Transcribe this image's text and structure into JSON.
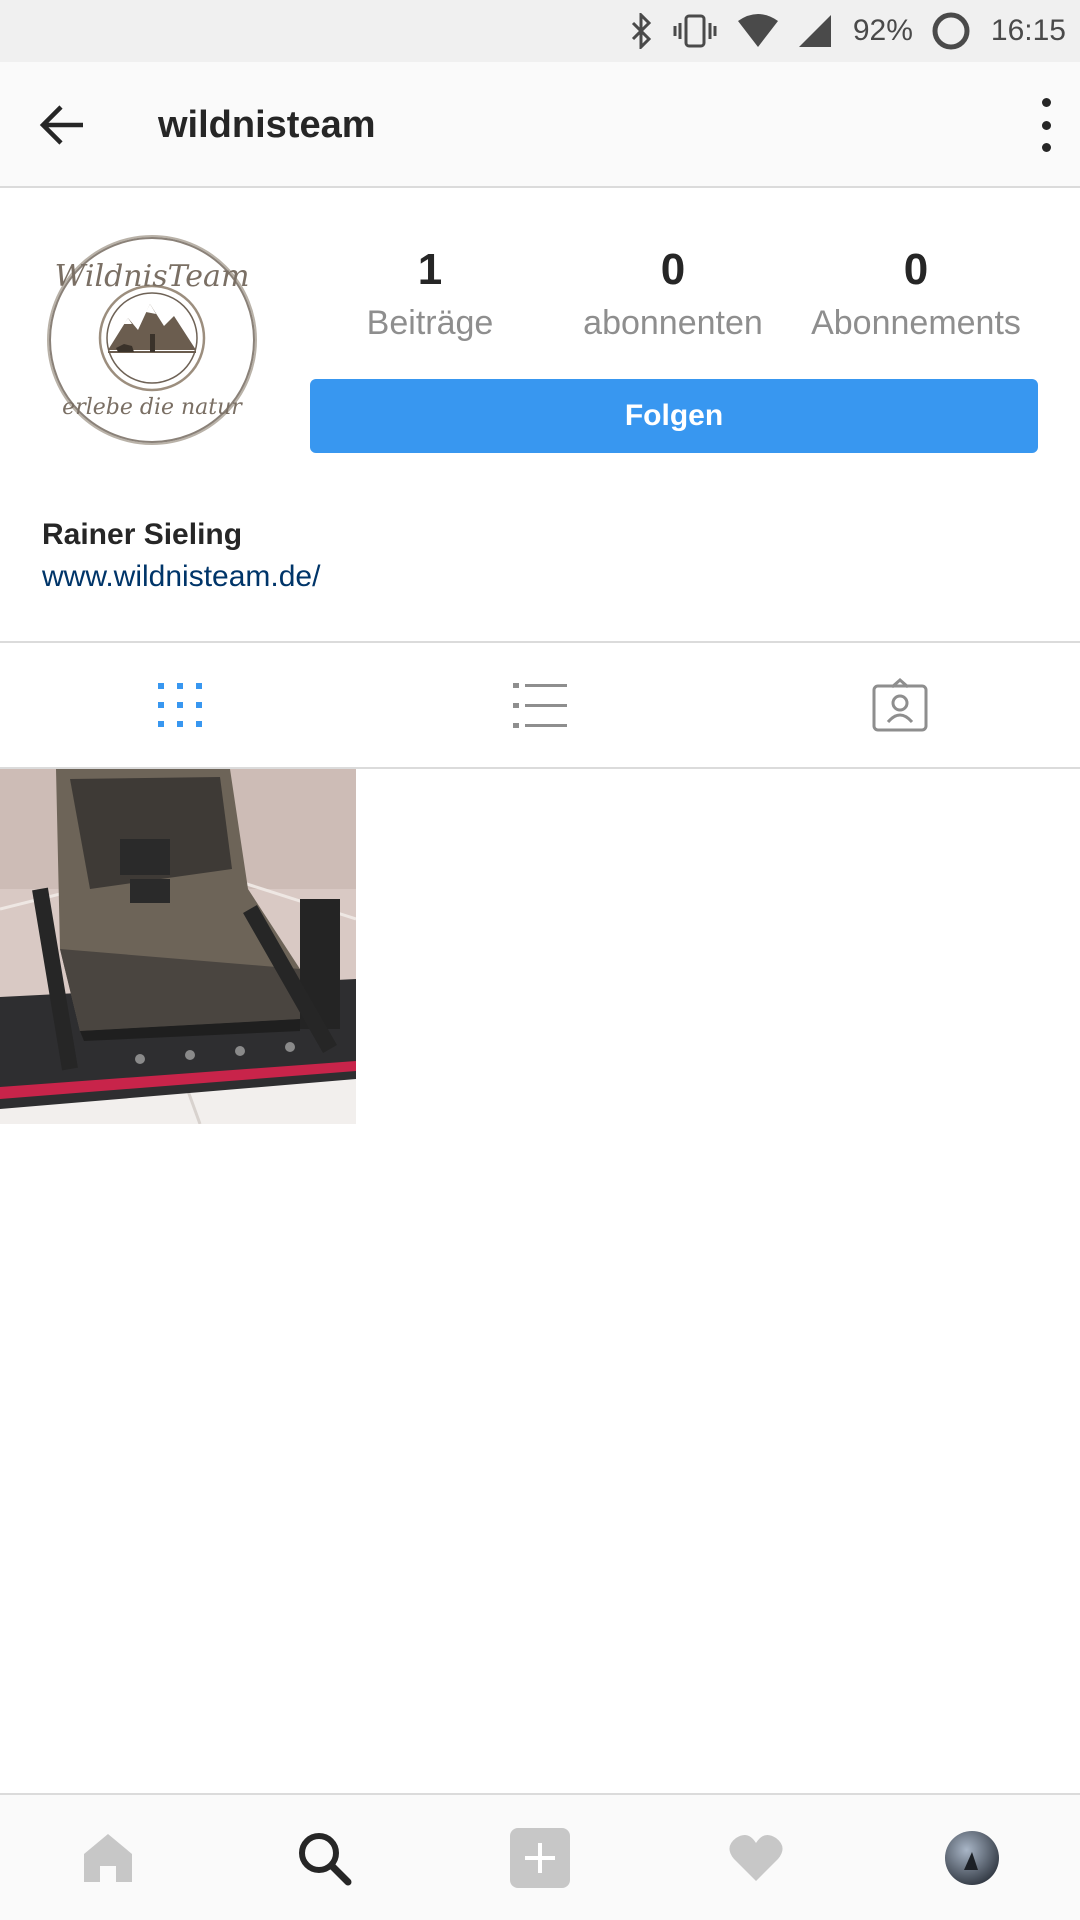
{
  "status_bar": {
    "battery_percent": "92%",
    "time": "16:15",
    "icons": [
      "bluetooth-icon",
      "vibrate-icon",
      "wifi-icon",
      "cell-signal-icon",
      "battery-icon"
    ]
  },
  "app_bar": {
    "title": "wildnisteam",
    "back_icon": "arrow-left-icon",
    "more_icon": "more-vertical-icon"
  },
  "profile": {
    "avatar_logo_text": "WildnisTeam",
    "avatar_tagline": "erlebe die natur",
    "stats": [
      {
        "value": "1",
        "label": "Beiträge"
      },
      {
        "value": "0",
        "label": "abonnenten"
      },
      {
        "value": "0",
        "label": "Abonnements"
      }
    ],
    "follow_label": "Folgen",
    "name": "Rainer Sieling",
    "website": "www.wildnisteam.de/"
  },
  "tabs": [
    {
      "icon": "grid-icon",
      "active": true
    },
    {
      "icon": "list-icon",
      "active": false
    },
    {
      "icon": "tagged-icon",
      "active": false
    }
  ],
  "posts": [
    {
      "description_icon": "photo-thumbnail"
    }
  ],
  "bottom_nav": [
    {
      "icon": "home-icon"
    },
    {
      "icon": "search-icon"
    },
    {
      "icon": "add-post-icon"
    },
    {
      "icon": "heart-icon"
    },
    {
      "icon": "profile-avatar-icon"
    }
  ],
  "colors": {
    "accent": "#3897f0",
    "link": "#003569",
    "muted": "#8e8e8e",
    "text": "#262626"
  }
}
